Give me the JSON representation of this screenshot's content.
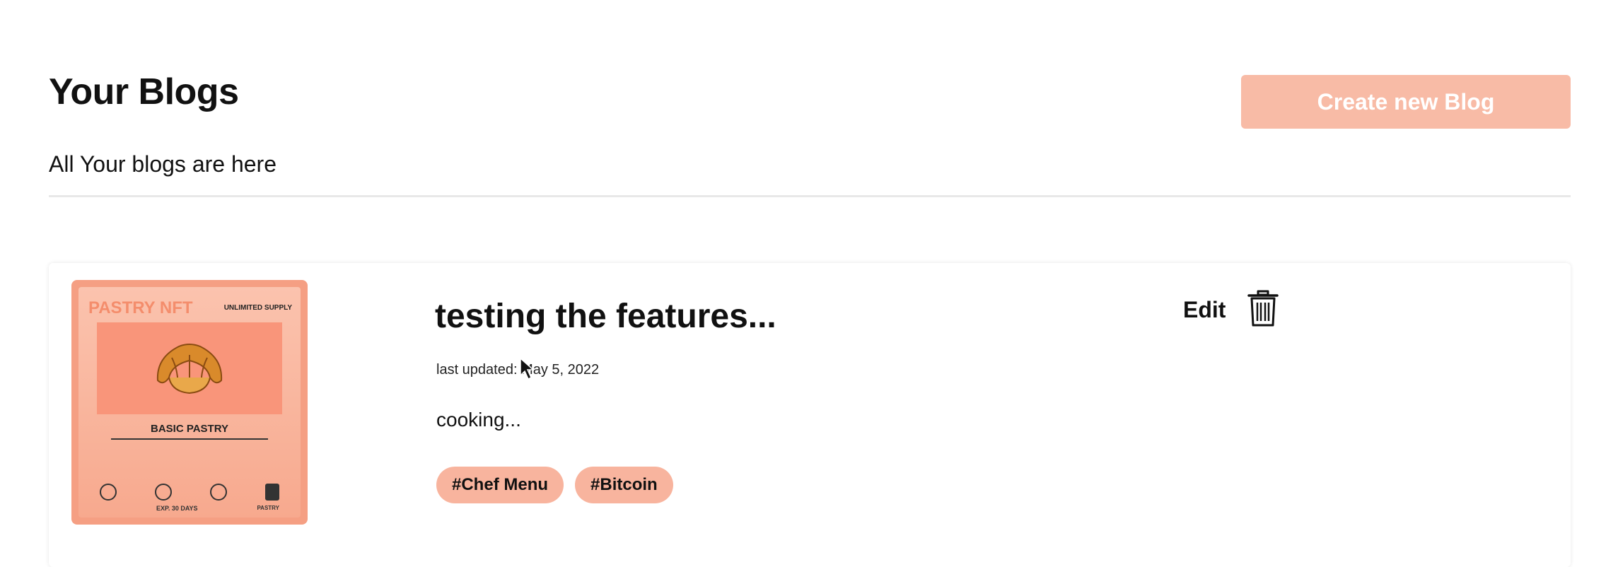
{
  "header": {
    "title": "Your Blogs",
    "subtitle": "All Your blogs are here",
    "create_button_label": "Create new Blog"
  },
  "blogs": [
    {
      "title": "testing the features...",
      "updated": "last updated: May 5, 2022",
      "excerpt": "cooking...",
      "tags": [
        "#Chef Menu",
        "#Bitcoin"
      ],
      "edit_label": "Edit",
      "thumbnail": {
        "brand": "PASTRY NFT",
        "supply": "UNLIMITED SUPPLY",
        "name": "BASIC PASTRY",
        "expiry": "EXP. 30 DAYS",
        "footer": "PASTRY"
      }
    }
  ],
  "icons": {
    "delete": "trash-icon",
    "cursor": "mouse-pointer-icon"
  },
  "colors": {
    "accent": "#f8bba6",
    "tag": "#f8b49e",
    "thumbnail": "#f59f83"
  }
}
